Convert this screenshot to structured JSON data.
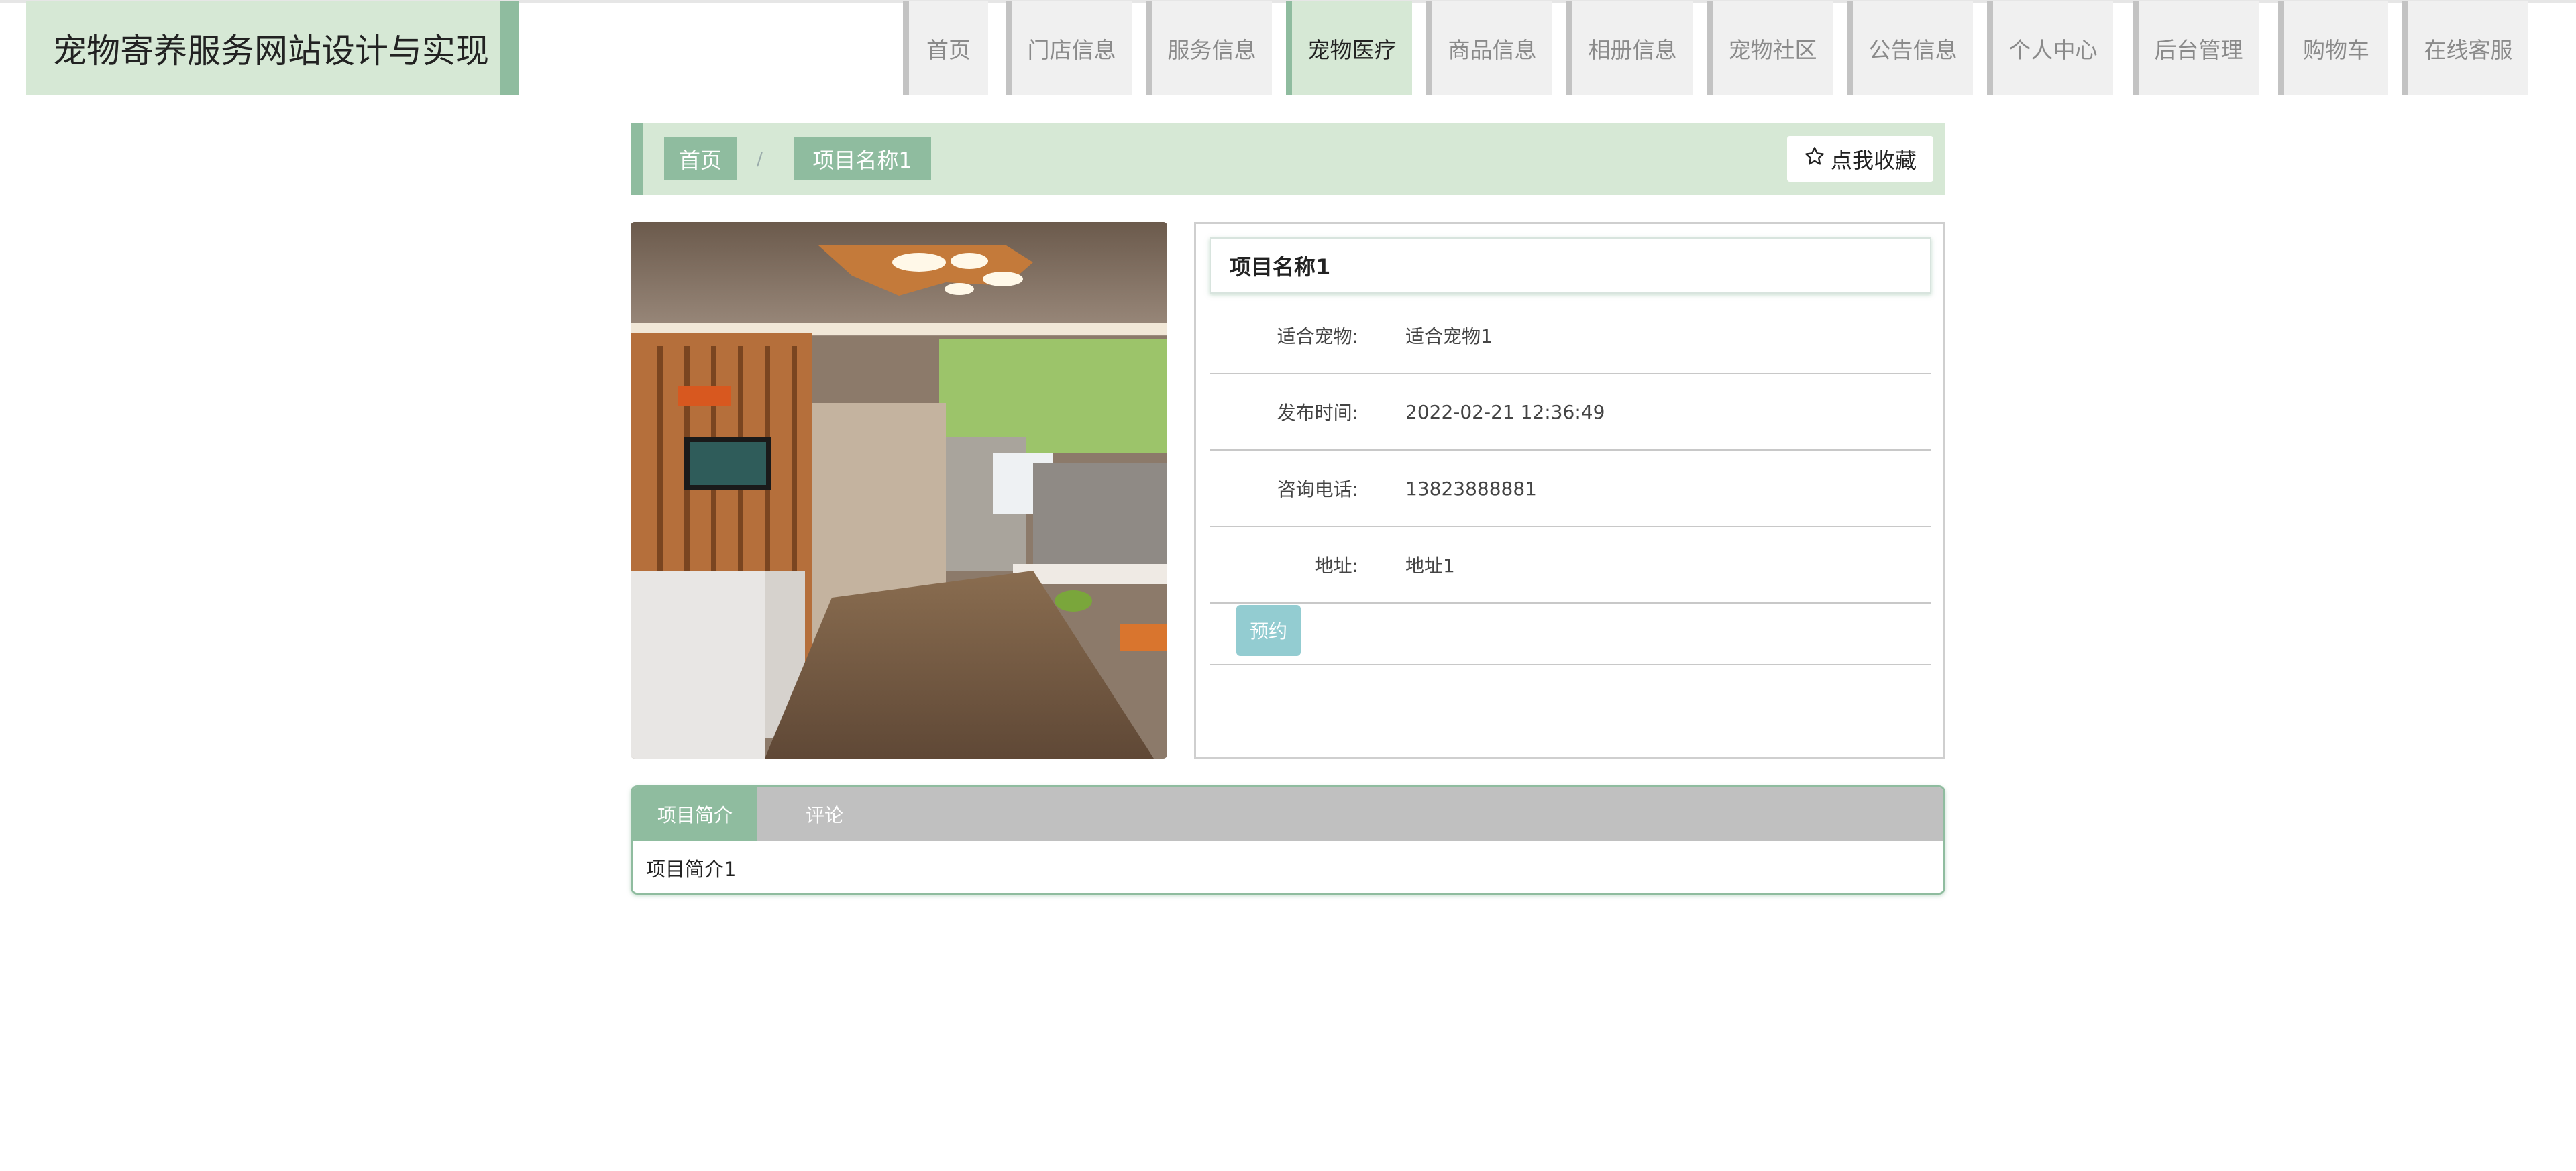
{
  "site": {
    "title": "宠物寄养服务网站设计与实现"
  },
  "nav": {
    "items": [
      {
        "label": "首页",
        "w": 127
      },
      {
        "label": "门店信息",
        "w": 188
      },
      {
        "label": "服务信息",
        "w": 188
      },
      {
        "label": "宠物医疗",
        "w": 188,
        "active": true
      },
      {
        "label": "商品信息",
        "w": 188
      },
      {
        "label": "相册信息",
        "w": 188
      },
      {
        "label": "宠物社区",
        "w": 188
      },
      {
        "label": "公告信息",
        "w": 188
      },
      {
        "label": "个人中心",
        "w": 188
      },
      {
        "label": "后台管理",
        "w": 188
      },
      {
        "label": "购物车",
        "w": 152
      },
      {
        "label": "在线客服",
        "w": 188
      }
    ]
  },
  "breadcrumb": {
    "home": "首页",
    "separator": "/",
    "current": "项目名称1"
  },
  "favorite": {
    "label": "点我收藏"
  },
  "detail": {
    "name": "项目名称1",
    "fields": [
      {
        "label": "适合宠物:",
        "value": "适合宠物1"
      },
      {
        "label": "发布时间:",
        "value": "2022-02-21 12:36:49"
      },
      {
        "label": "咨询电话:",
        "value": "13823888881"
      },
      {
        "label": "地址:",
        "value": "地址1"
      }
    ],
    "book_label": "预约"
  },
  "tabs": {
    "items": [
      {
        "label": "项目简介",
        "active": true
      },
      {
        "label": "评论"
      }
    ],
    "content": "项目简介1"
  },
  "colors": {
    "accent": "#8fbc9f",
    "accent_light": "#d6e8d5",
    "button": "#93ccd1",
    "tab_bar": "#c0c0c0"
  }
}
